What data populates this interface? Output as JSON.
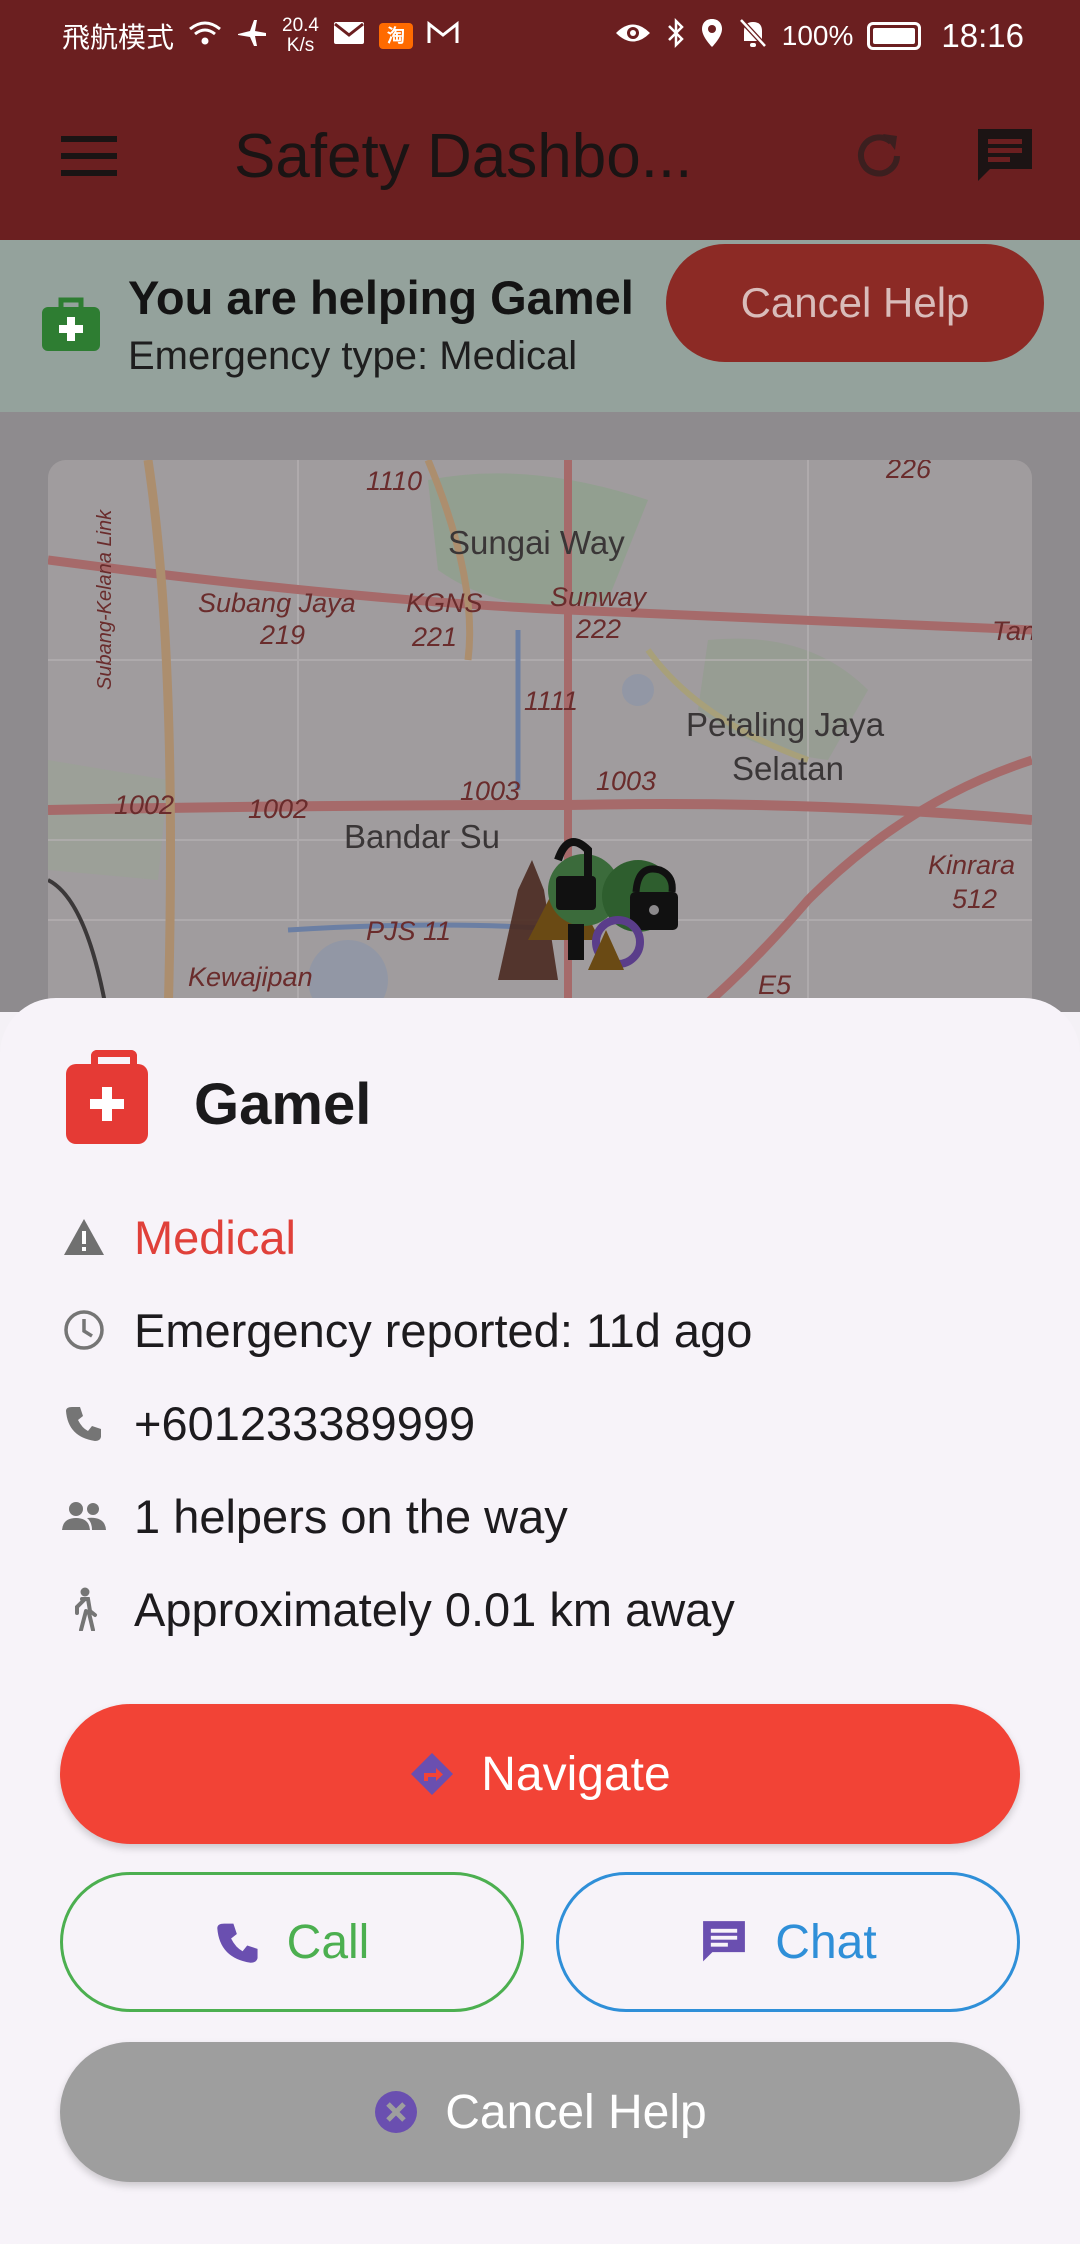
{
  "status_bar": {
    "airplane_mode": "飛航模式",
    "speed_value": "20.4",
    "speed_unit": "K/s",
    "taobao_badge": "淘",
    "battery": "100%",
    "time": "18:16"
  },
  "app_bar": {
    "title": "Safety Dashbo...",
    "menu_icon": "hamburger-menu-icon",
    "refresh_icon": "refresh-icon",
    "messages_icon": "chat-bubble-icon"
  },
  "banner": {
    "title": "You are helping Gamel",
    "subtitle": "Emergency type: Medical",
    "cancel_label": "Cancel Help",
    "icon": "medical-kit-icon",
    "icon_color": "#2e7d32"
  },
  "map": {
    "labels": [
      "Sungai Way",
      "Subang Jaya",
      "KGNS",
      "Sunway",
      "Petaling Jaya",
      "Selatan",
      "Bandar Su",
      "Kinrara",
      "Kewajipan",
      "Subang-Kelana Link"
    ],
    "road_numbers": [
      "1110",
      "226",
      "219",
      "221",
      "222",
      "1111",
      "1003",
      "1003",
      "1002",
      "1002",
      "512",
      "PJS 11",
      "E5",
      "Tan"
    ]
  },
  "sheet": {
    "name": "Gamel",
    "emergency_type": "Medical",
    "reported": "Emergency reported: 11d ago",
    "phone": "+601233389999",
    "helpers": "1 helpers on the way",
    "distance": "Approximately 0.01 km away",
    "buttons": {
      "navigate": "Navigate",
      "call": "Call",
      "chat": "Chat",
      "cancel": "Cancel Help"
    }
  },
  "colors": {
    "app_bar": "#6b1f20",
    "accent_red": "#f24336",
    "call_green": "#4caf50",
    "chat_blue": "#2f8fd8",
    "cancel_gray": "#9e9e9e",
    "icon_purple": "#6a4fb0"
  }
}
